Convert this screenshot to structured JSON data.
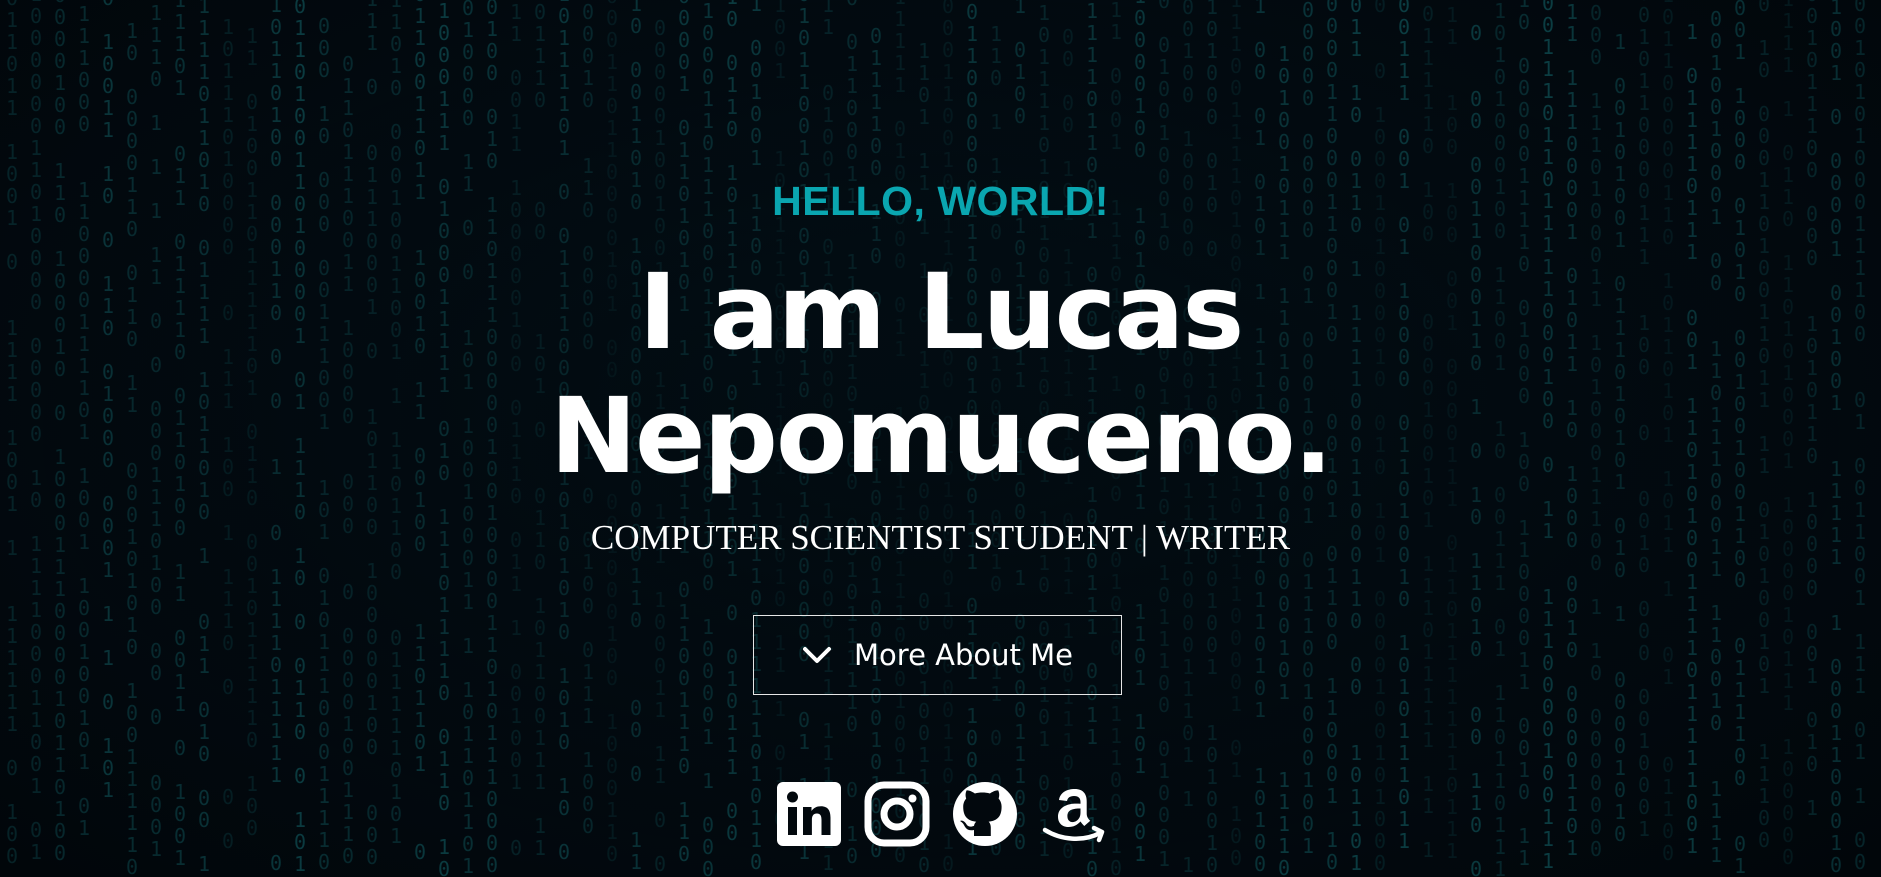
{
  "hero": {
    "greeting": "HELLO, WORLD!",
    "name_line1": "I am Lucas",
    "name_line2": "Nepomuceno.",
    "subtitle": "COMPUTER SCIENTIST STUDENT | WRITER",
    "cta_label": "More About Me",
    "cta_icon": "chevron-down-icon"
  },
  "social": [
    {
      "icon": "linkedin-icon"
    },
    {
      "icon": "instagram-icon"
    },
    {
      "icon": "github-icon"
    },
    {
      "icon": "amazon-icon"
    }
  ],
  "colors": {
    "background": "#02080d",
    "accent": "#0aa6b0",
    "text": "#ffffff",
    "matrix_digits": "#0e4a4f"
  }
}
